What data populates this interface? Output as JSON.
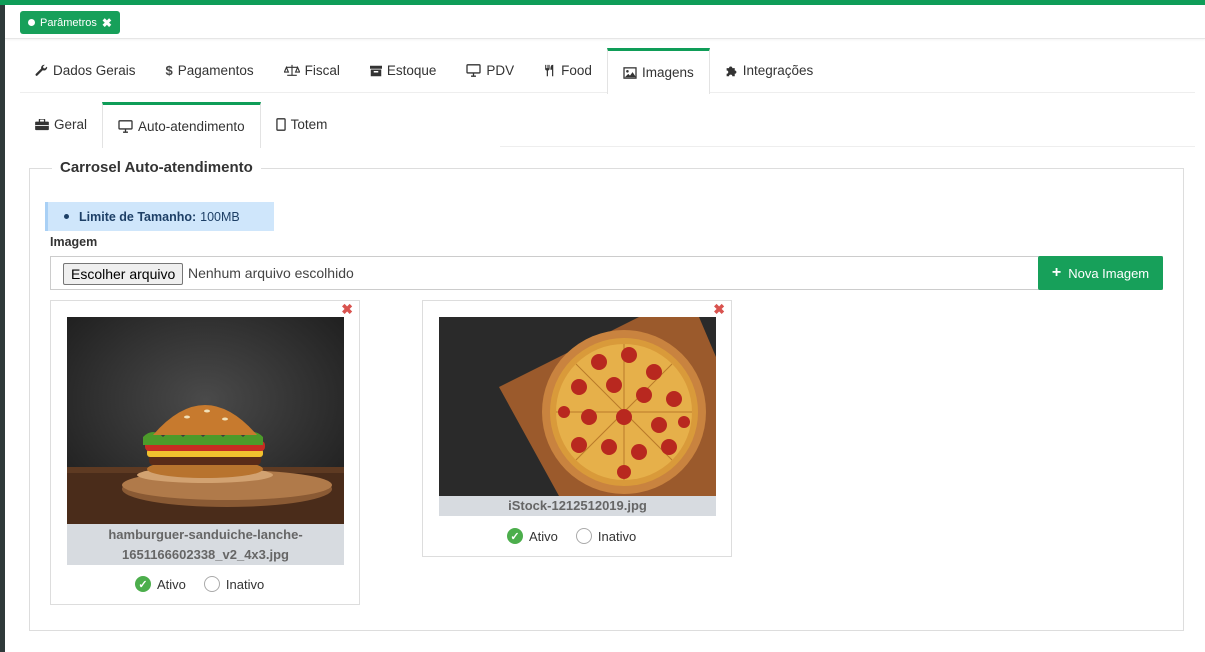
{
  "pill": {
    "label": "Parâmetros",
    "close": "✖"
  },
  "tabs": [
    {
      "label": "Dados Gerais",
      "icon": "wrench-icon"
    },
    {
      "label": "Pagamentos",
      "icon": "dollar-icon"
    },
    {
      "label": "Fiscal",
      "icon": "balance-icon"
    },
    {
      "label": "Estoque",
      "icon": "archive-icon"
    },
    {
      "label": "PDV",
      "icon": "monitor-icon"
    },
    {
      "label": "Food",
      "icon": "cutlery-icon"
    },
    {
      "label": "Imagens",
      "icon": "image-icon"
    },
    {
      "label": "Integrações",
      "icon": "puzzle-icon"
    }
  ],
  "subtabs": [
    {
      "label": "Geral",
      "icon": "briefcase-icon"
    },
    {
      "label": "Auto-atendimento",
      "icon": "monitor-icon"
    },
    {
      "label": "Totem",
      "icon": "tablet-icon"
    }
  ],
  "section": {
    "title": "Carrosel Auto-atendimento"
  },
  "alert": {
    "label": "Limite de Tamanho:",
    "value": "100MB"
  },
  "image_field": {
    "label": "Imagem",
    "button": "Escolher arquivo",
    "status": "Nenhum arquivo escolhido"
  },
  "new_button": {
    "label": "Nova Imagem"
  },
  "cards": [
    {
      "caption": "hamburguer-sanduiche-lanche-1651166602338_v2_4x3.jpg",
      "active_label": "Ativo",
      "inactive_label": "Inativo",
      "status": "Ativo"
    },
    {
      "caption": "iStock-1212512019.jpg",
      "active_label": "Ativo",
      "inactive_label": "Inativo",
      "status": "Ativo"
    }
  ],
  "colors": {
    "accent": "#0f9d58",
    "button": "#17a05a",
    "delete": "#d9534f"
  }
}
